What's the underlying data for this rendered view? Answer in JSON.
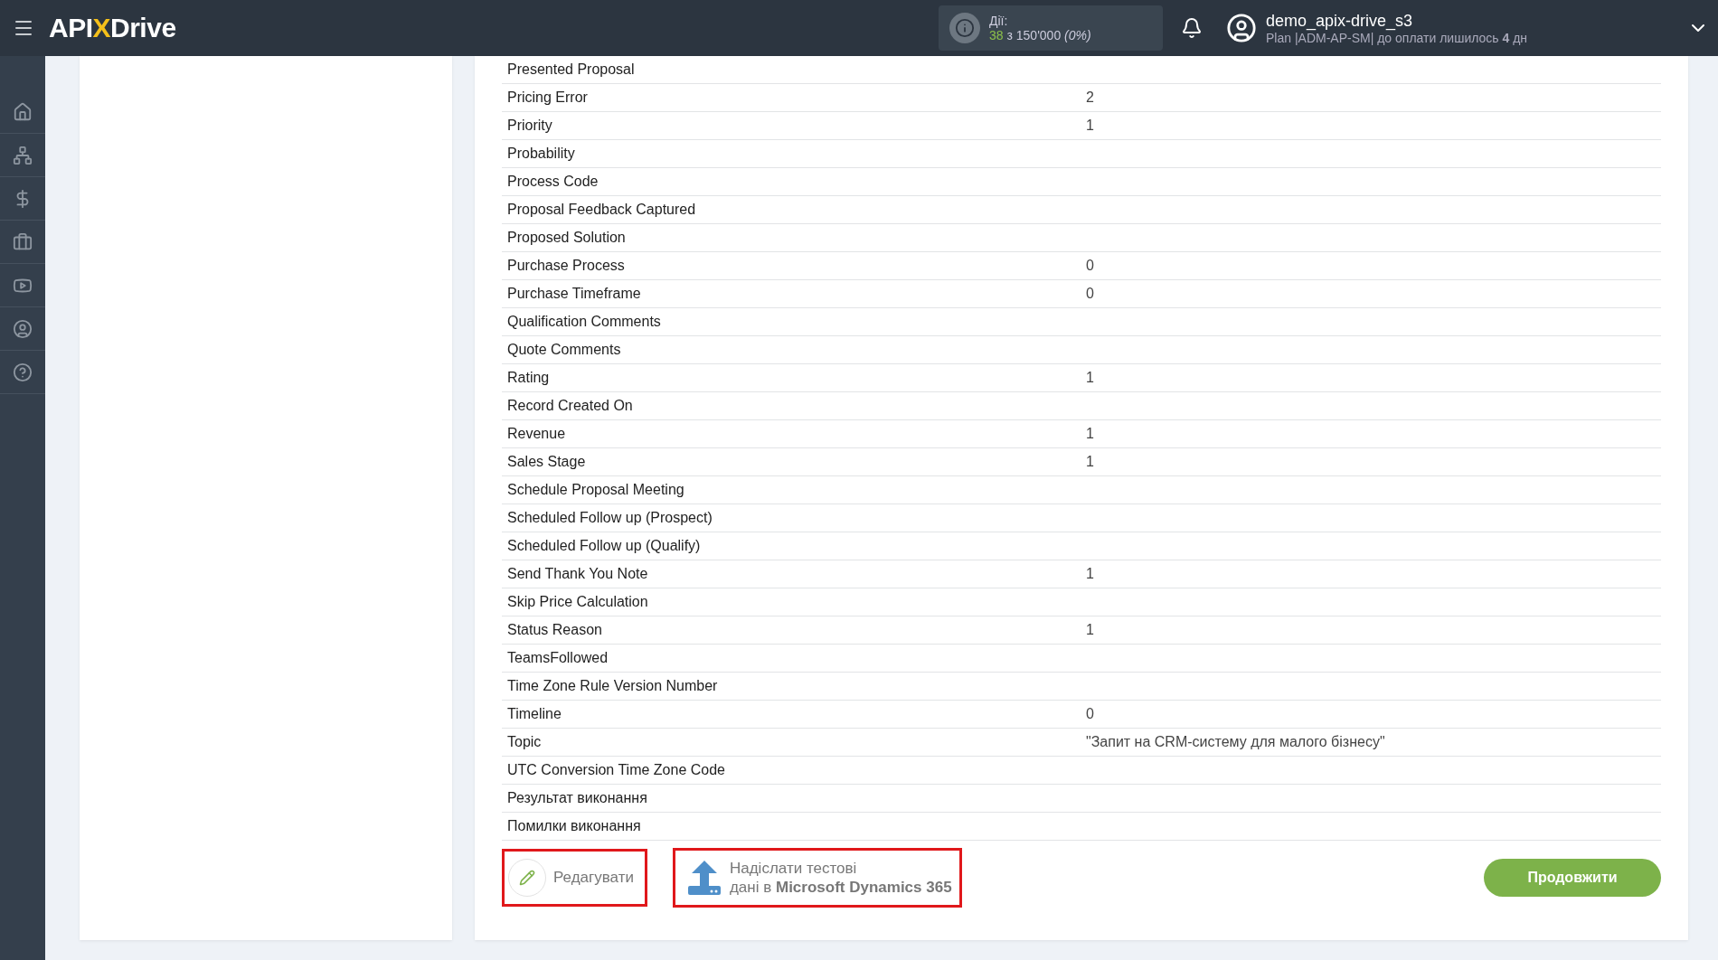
{
  "header": {
    "logo": {
      "left": "API",
      "mark": "X",
      "right": "Drive"
    },
    "usage": {
      "label": "Дії:",
      "used": "38",
      "of": "з 150'000",
      "percent": "(0%)"
    },
    "user": {
      "name": "demo_apix-drive_s3",
      "plan": "Plan |ADM-AP-SM| до оплати лишилось **4** дн"
    }
  },
  "table": {
    "rows": [
      {
        "field": "Presented Proposal",
        "value": ""
      },
      {
        "field": "Pricing Error",
        "value": "2"
      },
      {
        "field": "Priority",
        "value": "1"
      },
      {
        "field": "Probability",
        "value": ""
      },
      {
        "field": "Process Code",
        "value": ""
      },
      {
        "field": "Proposal Feedback Captured",
        "value": ""
      },
      {
        "field": "Proposed Solution",
        "value": ""
      },
      {
        "field": "Purchase Process",
        "value": "0"
      },
      {
        "field": "Purchase Timeframe",
        "value": "0"
      },
      {
        "field": "Qualification Comments",
        "value": ""
      },
      {
        "field": "Quote Comments",
        "value": ""
      },
      {
        "field": "Rating",
        "value": "1"
      },
      {
        "field": "Record Created On",
        "value": ""
      },
      {
        "field": "Revenue",
        "value": "1"
      },
      {
        "field": "Sales Stage",
        "value": "1"
      },
      {
        "field": "Schedule Proposal Meeting",
        "value": ""
      },
      {
        "field": "Scheduled Follow up (Prospect)",
        "value": ""
      },
      {
        "field": "Scheduled Follow up (Qualify)",
        "value": ""
      },
      {
        "field": "Send Thank You Note",
        "value": "1"
      },
      {
        "field": "Skip Price Calculation",
        "value": ""
      },
      {
        "field": "Status Reason",
        "value": "1"
      },
      {
        "field": "TeamsFollowed",
        "value": ""
      },
      {
        "field": "Time Zone Rule Version Number",
        "value": ""
      },
      {
        "field": "Timeline",
        "value": "0"
      },
      {
        "field": "Topic",
        "value": "\"Запит на CRM-систему для малого бізнесу\""
      },
      {
        "field": "UTC Conversion Time Zone Code",
        "value": ""
      },
      {
        "field": "Результат виконання",
        "value": ""
      },
      {
        "field": "Помилки виконання",
        "value": ""
      }
    ]
  },
  "actions": {
    "edit": {
      "label": "Редагувати",
      "highlighted": true
    },
    "send": {
      "label": "Надіслати тестові\nдані в **Microsoft Dynamics 365**",
      "highlighted": true
    },
    "continue": {
      "label": "Продовжити"
    }
  }
}
